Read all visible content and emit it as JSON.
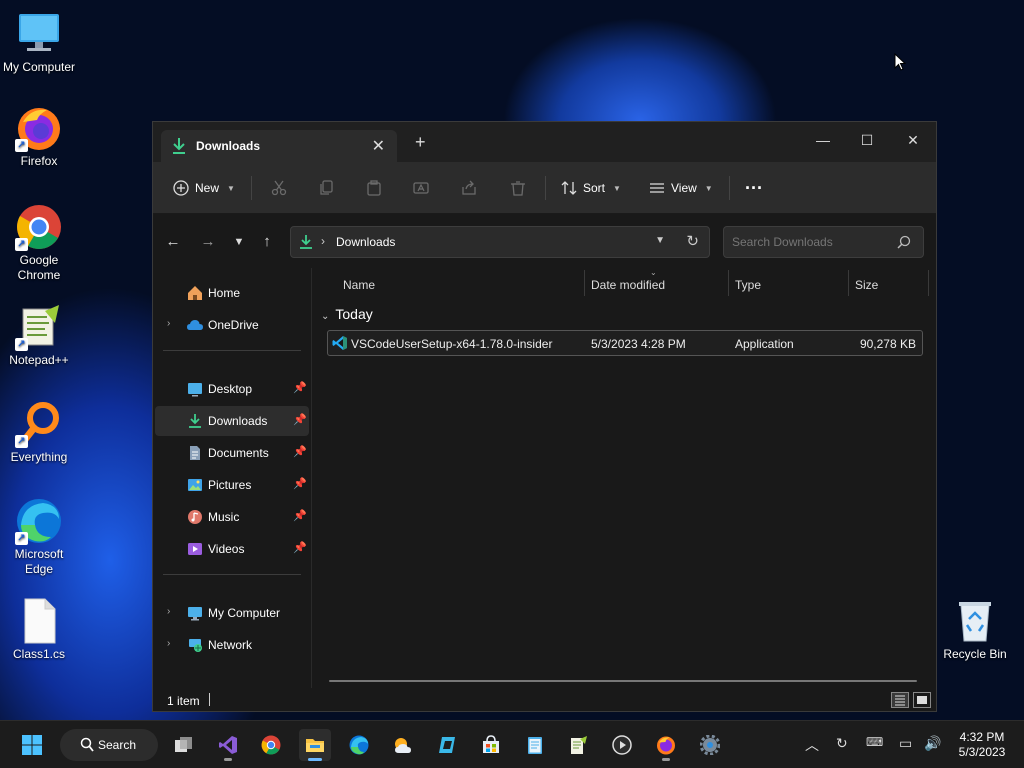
{
  "desktop": {
    "icons": [
      {
        "label": "My Computer"
      },
      {
        "label": "Firefox"
      },
      {
        "label": "Google Chrome"
      },
      {
        "label": "Notepad++"
      },
      {
        "label": "Everything"
      },
      {
        "label": "Microsoft Edge"
      },
      {
        "label": "Class1.cs"
      },
      {
        "label": "Recycle Bin"
      }
    ]
  },
  "explorer": {
    "tab": {
      "label": "Downloads",
      "close": "✕"
    },
    "new_tab": "+",
    "window_controls": {
      "minimize": "—",
      "maximize": "☐",
      "close": "✕"
    },
    "toolbar": {
      "new_label": "New",
      "sort_label": "Sort",
      "view_label": "View",
      "more_label": "···"
    },
    "address": {
      "location": "Downloads"
    },
    "search": {
      "placeholder": "Search Downloads"
    },
    "nav": {
      "items": [
        {
          "label": "Home"
        },
        {
          "label": "OneDrive"
        },
        {
          "label": "Desktop"
        },
        {
          "label": "Downloads"
        },
        {
          "label": "Documents"
        },
        {
          "label": "Pictures"
        },
        {
          "label": "Music"
        },
        {
          "label": "Videos"
        },
        {
          "label": "My Computer"
        },
        {
          "label": "Network"
        }
      ]
    },
    "columns": {
      "name": "Name",
      "date": "Date modified",
      "type": "Type",
      "size": "Size"
    },
    "group": {
      "label": "Today"
    },
    "files": [
      {
        "name": "VSCodeUserSetup-x64-1.78.0-insider",
        "date": "5/3/2023 4:28 PM",
        "type": "Application",
        "size": "90,278 KB"
      }
    ],
    "status": {
      "count": "1 item"
    }
  },
  "taskbar": {
    "search_label": "Search",
    "clock": {
      "time": "4:32 PM",
      "date": "5/3/2023"
    }
  },
  "colors": {
    "accent": "#4cc2ff",
    "downloads_green": "#3fcf8e",
    "window_bg": "#191919",
    "taskbar_bg": "#1c1c1c"
  }
}
